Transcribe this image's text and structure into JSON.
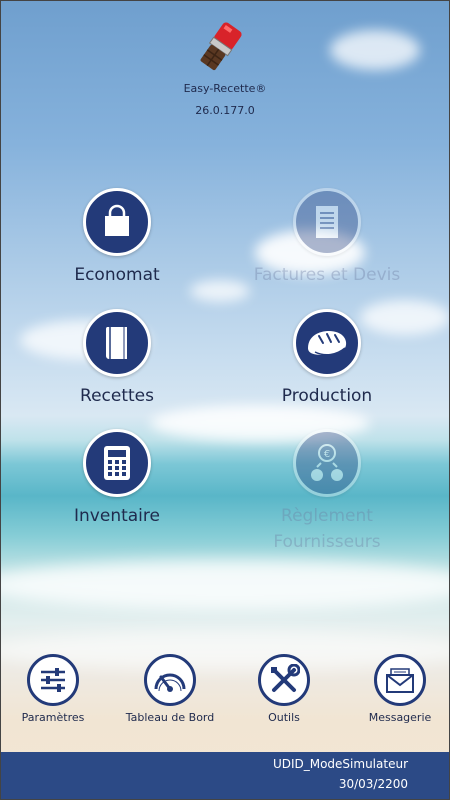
{
  "app": {
    "name": "Easy-Recette®",
    "version": "26.0.177.0"
  },
  "tiles": [
    {
      "label": "Economat",
      "icon": "shopping-bag-icon",
      "enabled": true
    },
    {
      "label": "Factures et Devis",
      "icon": "document-icon",
      "enabled": false
    },
    {
      "label": "Recettes",
      "icon": "book-icon",
      "enabled": true
    },
    {
      "label": "Production",
      "icon": "bread-icon",
      "enabled": true
    },
    {
      "label": "Inventaire",
      "icon": "calculator-icon",
      "enabled": true
    },
    {
      "label_line1": "Règlement",
      "label_line2": "Fournisseurs",
      "icon": "money-transfer-icon",
      "enabled": false
    }
  ],
  "toolbar": [
    {
      "label": "Paramètres",
      "icon": "sliders-icon"
    },
    {
      "label": "Tableau de Bord",
      "icon": "gauge-icon"
    },
    {
      "label": "Outils",
      "icon": "tools-icon"
    },
    {
      "label": "Messagerie",
      "icon": "envelope-icon"
    }
  ],
  "footer": {
    "udid": "UDID_ModeSimulateur",
    "date": "30/03/2200"
  },
  "colors": {
    "accent": "#233a79",
    "footer_bg": "#2c4a86",
    "text": "#1f2a4d"
  }
}
